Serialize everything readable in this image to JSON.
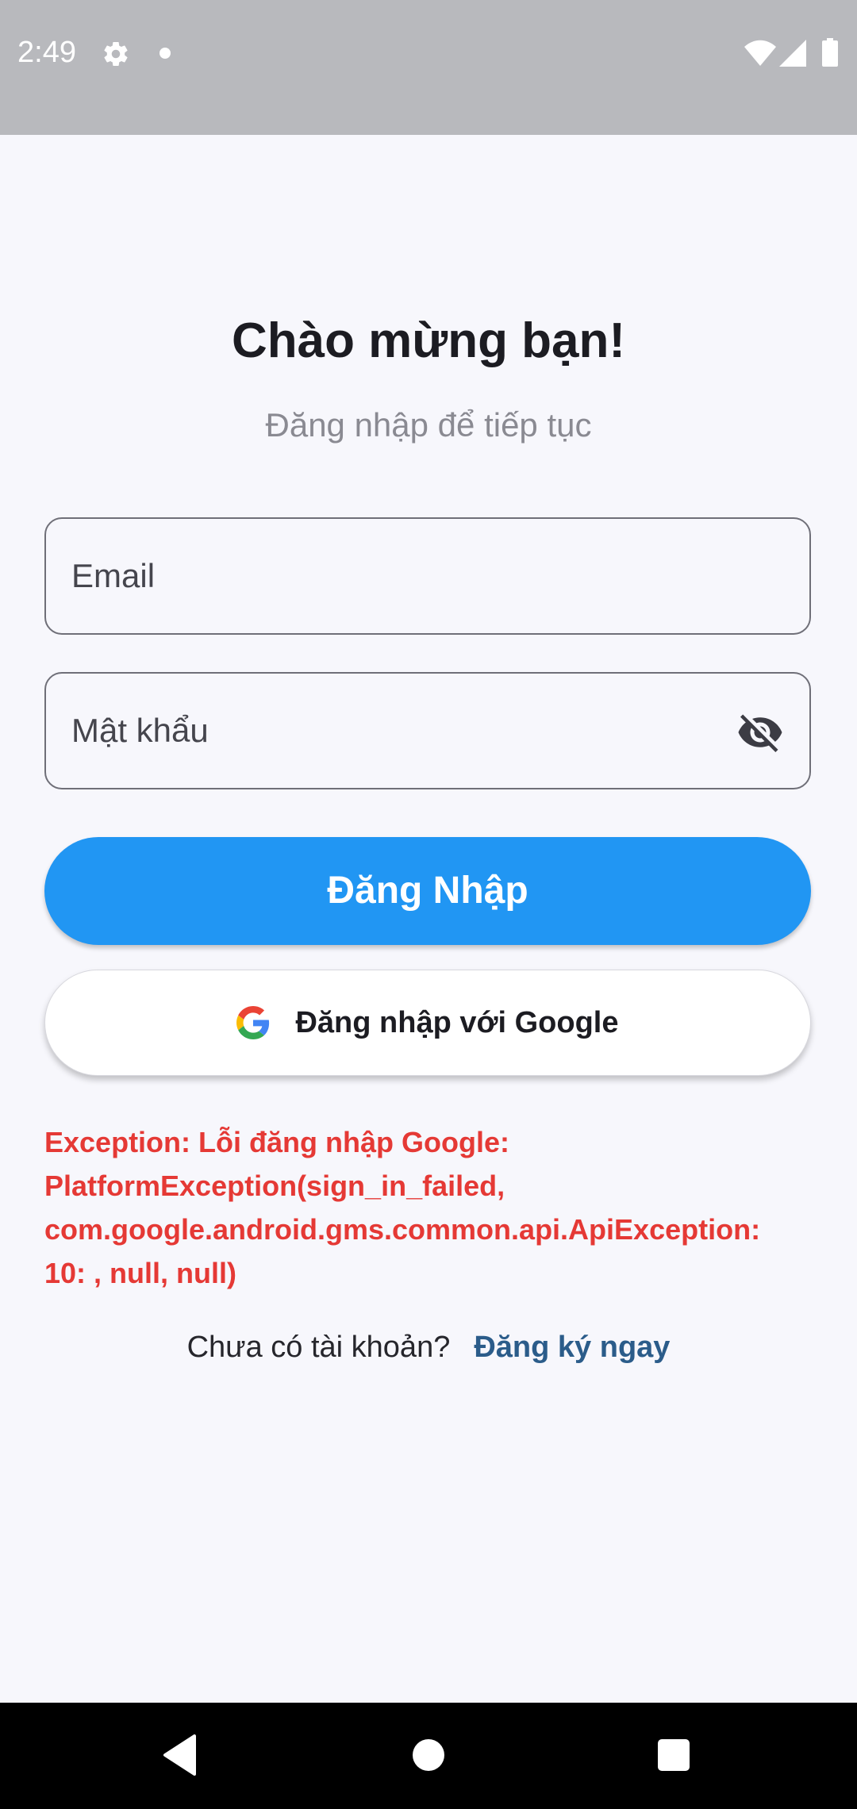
{
  "status_bar": {
    "time": "2:49",
    "icons": [
      "gear-icon",
      "notification-dot-icon",
      "wifi-icon",
      "signal-icon",
      "battery-icon"
    ]
  },
  "header": {
    "title": "Chào mừng bạn!",
    "subtitle": "Đăng nhập để tiếp tục"
  },
  "form": {
    "email_placeholder": "Email",
    "password_placeholder": "Mật khẩu",
    "password_toggle_icon": "eye-off-icon"
  },
  "buttons": {
    "login_label": "Đăng Nhập",
    "google_label": "Đăng nhập với Google"
  },
  "error": {
    "message": "Exception: Lỗi đăng nhập Google:\nPlatformException(sign_in_failed,\ncom.google.android.gms.common.api.ApiException:\n10: , null, null)"
  },
  "signup": {
    "prompt": "Chưa có tài khoản?",
    "link": "Đăng ký ngay"
  },
  "nav_bar": {
    "icons": [
      "back-icon",
      "home-icon",
      "recents-icon"
    ]
  },
  "colors": {
    "background": "#f7f7fc",
    "status_bar": "#b8b9bd",
    "primary": "#2196f3",
    "error": "#e53935",
    "link": "#2b5c8a"
  }
}
